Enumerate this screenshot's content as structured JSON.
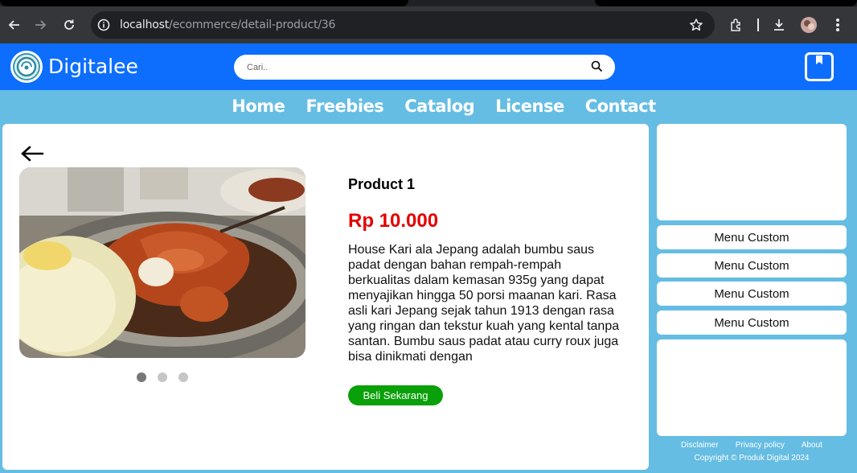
{
  "browser": {
    "url_host": "localhost",
    "url_path": "/ecommerce/detail-product/36"
  },
  "header": {
    "brand": "Digitalee",
    "search_placeholder": "Cari.."
  },
  "nav": {
    "items": [
      "Home",
      "Freebies",
      "Catalog",
      "License",
      "Contact"
    ]
  },
  "product": {
    "title": "Product 1",
    "price": "Rp 10.000",
    "description": "House Kari ala Jepang adalah bumbu saus padat dengan bahan rempah-rempah berkualitas dalam kemasan 935g yang dapat menyajikan hingga 50 porsi maanan kari. Rasa asli kari Jepang sejak tahun 1913 dengan rasa yang ringan dan tekstur kuah yang kental tanpa santan. Bumbu saus padat atau curry roux juga bisa dinikmati dengan",
    "buy_label": "Beli Sekarang",
    "carousel_active": 1,
    "carousel_count": 3
  },
  "sidebar": {
    "menus": [
      "Menu Custom",
      "Menu Custom",
      "Menu Custom",
      "Menu Custom"
    ]
  },
  "footer": {
    "links": [
      "Disclaimer",
      "Privacy policy",
      "About"
    ],
    "copyright": "Copyright © Produk Digital 2024"
  },
  "colors": {
    "header": "#0d6efd",
    "background": "#66bde3",
    "price": "#e60000",
    "buy_button": "#0aa00a"
  }
}
